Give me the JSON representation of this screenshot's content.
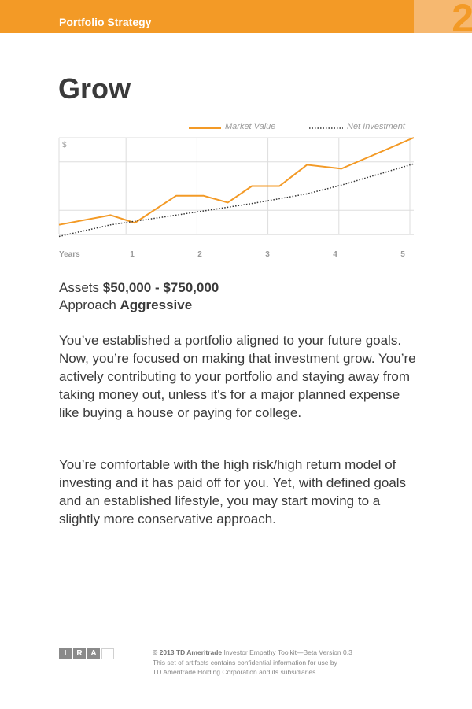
{
  "header": {
    "title": "Portfolio Strategy",
    "page_number": "2"
  },
  "title": "Grow",
  "chart_data": {
    "type": "line",
    "x": [
      0,
      0.75,
      1.1,
      1.7,
      2.1,
      2.45,
      2.8,
      3.2,
      3.6,
      4.1,
      5.15
    ],
    "series": [
      {
        "name": "Market Value",
        "color": "#f39a26",
        "style": "solid",
        "values": [
          0.5,
          1.0,
          0.6,
          2.0,
          2.0,
          1.65,
          2.5,
          2.5,
          3.6,
          3.4,
          5.0
        ]
      },
      {
        "name": "Net Investment",
        "color": "#333333",
        "style": "dotted",
        "x": [
          0,
          0.75,
          1.7,
          2.8,
          3.6,
          4.1,
          5.15
        ],
        "values": [
          -0.1,
          0.5,
          1.0,
          1.6,
          2.1,
          2.55,
          3.65
        ]
      }
    ],
    "y_label": "$",
    "x_label": "Years",
    "x_ticks": [
      "1",
      "2",
      "3",
      "4",
      "5"
    ],
    "xlim": [
      0,
      5.15
    ],
    "ylim": [
      0,
      5
    ],
    "grid": true,
    "legend": "top-right"
  },
  "assets": {
    "label": "Assets",
    "value": "$50,000 - $750,000"
  },
  "approach": {
    "label": "Approach",
    "value": "Aggressive"
  },
  "paragraphs": [
    "You’ve established a portfolio aligned to your future goals. Now, you’re focused on making that investment grow. You’re actively contributing to your portfolio and staying away from taking money out, unless it's for a major planned expense like buying a house or paying for college.",
    "You’re comfortable with the high risk/high return model of investing and it has paid off for you. Yet, with defined goals and an established lifestyle, you may start moving to a slightly more conservative approach."
  ],
  "logo": [
    "I",
    "R",
    "A",
    ""
  ],
  "footer": {
    "copyright": "© 2013 TD Ameritrade",
    "line1_rest": " Investor Empathy Toolkit—Beta Version 0.3",
    "line2": "This set of artifacts contains confidential information for use by",
    "line3": "TD Ameritrade Holding Corporation and its subsidiaries."
  }
}
